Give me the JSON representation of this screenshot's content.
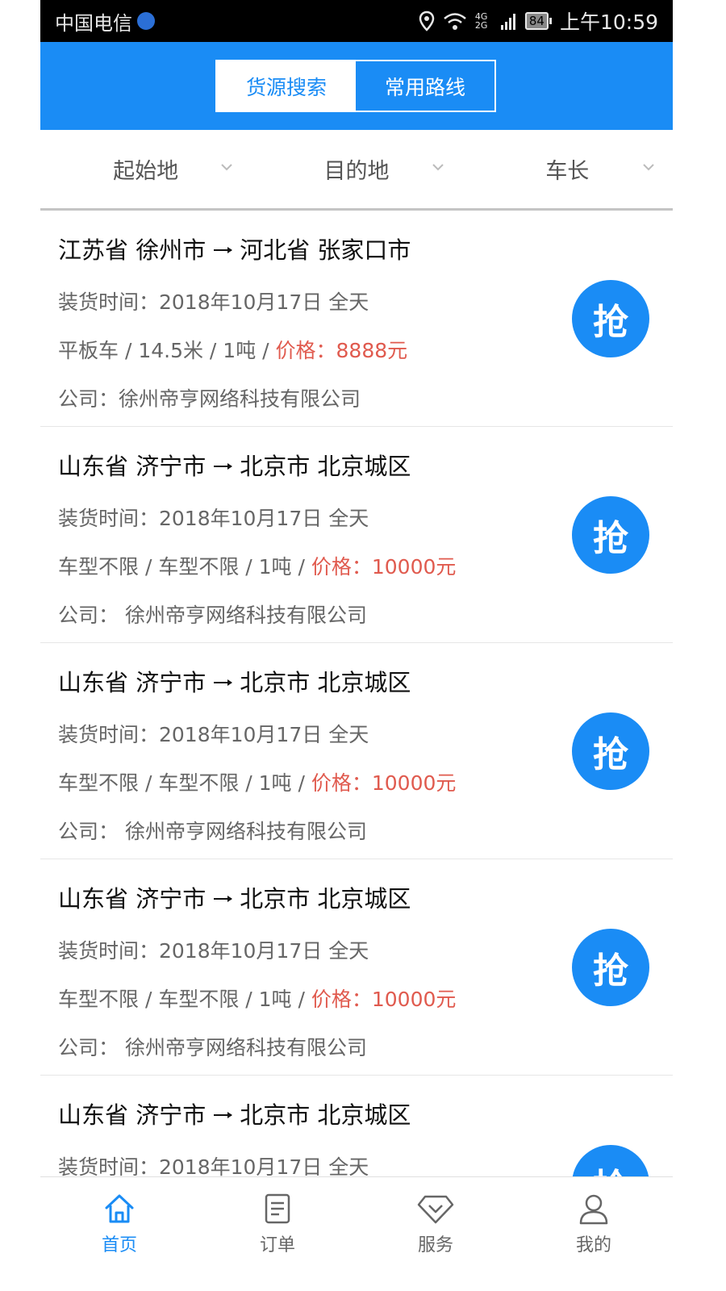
{
  "status_bar": {
    "carrier": "中国电信",
    "network": "4G 2G",
    "battery": "84",
    "time": "上午10:59"
  },
  "header": {
    "tabs": [
      {
        "label": "货源搜索",
        "active": true
      },
      {
        "label": "常用路线",
        "active": false
      }
    ],
    "accent_color": "#1a8cf5"
  },
  "filters": [
    {
      "label": "起始地"
    },
    {
      "label": "目的地"
    },
    {
      "label": "车长"
    }
  ],
  "listings": [
    {
      "origin": "江苏省 徐州市",
      "destination": "河北省 张家口市",
      "load_time": "装货时间：2018年10月17日 全天",
      "specs": "平板车 / 14.5米 / 1吨 / ",
      "price": "价格：8888元",
      "company": "公司：徐州帝亨网络科技有限公司",
      "action": "抢"
    },
    {
      "origin": "山东省 济宁市",
      "destination": "北京市 北京城区",
      "load_time": "装货时间：2018年10月17日 全天",
      "specs": "车型不限 / 车型不限 / 1吨 / ",
      "price": "价格：10000元",
      "company": "公司： 徐州帝亨网络科技有限公司",
      "action": "抢"
    },
    {
      "origin": "山东省 济宁市",
      "destination": "北京市 北京城区",
      "load_time": "装货时间：2018年10月17日 全天",
      "specs": "车型不限 / 车型不限 / 1吨 / ",
      "price": "价格：10000元",
      "company": "公司： 徐州帝亨网络科技有限公司",
      "action": "抢"
    },
    {
      "origin": "山东省 济宁市",
      "destination": "北京市 北京城区",
      "load_time": "装货时间：2018年10月17日 全天",
      "specs": "车型不限 / 车型不限 / 1吨 / ",
      "price": "价格：10000元",
      "company": "公司： 徐州帝亨网络科技有限公司",
      "action": "抢"
    },
    {
      "origin": "山东省 济宁市",
      "destination": "北京市 北京城区",
      "load_time": "装货时间：2018年10月17日 全天",
      "specs": "",
      "price": "",
      "company": "",
      "action": "抢"
    }
  ],
  "tab_bar": [
    {
      "label": "首页",
      "icon": "home-icon",
      "active": true
    },
    {
      "label": "订单",
      "icon": "order-icon",
      "active": false
    },
    {
      "label": "服务",
      "icon": "service-diamond-icon",
      "active": false
    },
    {
      "label": "我的",
      "icon": "user-icon",
      "active": false
    }
  ]
}
